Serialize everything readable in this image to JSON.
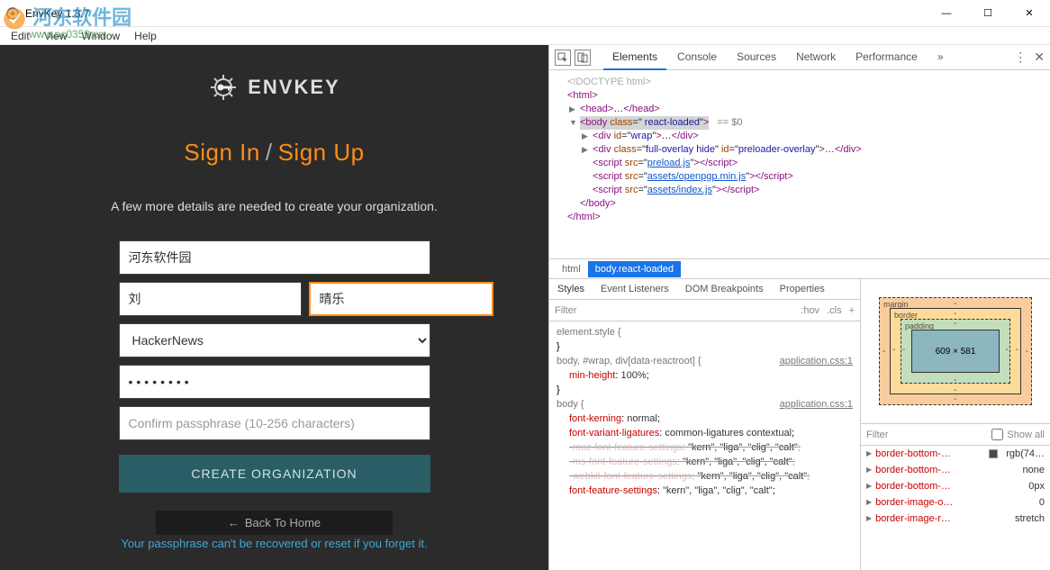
{
  "window": {
    "title": "EnvKey 1.3.7",
    "controls": {
      "min": "—",
      "max": "☐",
      "close": "✕"
    }
  },
  "menubar": {
    "items": [
      "Edit",
      "View",
      "Window",
      "Help"
    ]
  },
  "watermark": {
    "text": "河东软件园",
    "url": "www.pc0359.cn"
  },
  "logo": {
    "brand": "ENVKEY"
  },
  "heading": {
    "signin": "Sign In",
    "sep": "/",
    "signup": "Sign Up"
  },
  "subtext": "A few more details are needed to create your organization.",
  "form": {
    "org": "河东软件园",
    "first": "刘",
    "last": "晴乐",
    "source": "HackerNews",
    "pass": "••••••••",
    "confirm_placeholder": "Confirm passphrase (10-256 characters)",
    "submit": "CREATE ORGANIZATION"
  },
  "back": {
    "label": "Back To Home",
    "arrow": "←"
  },
  "warning": "Your passphrase can't be recovered or reset if you forget it.",
  "devtools": {
    "tabs": [
      "Elements",
      "Console",
      "Sources",
      "Network",
      "Performance"
    ],
    "more": "»",
    "tree": {
      "doctype": "<!DOCTYPE html>",
      "html_open": "<html>",
      "head": "head",
      "body_class": " react-loaded",
      "eq": " == $0",
      "wrap_id": "wrap",
      "overlay_class": "full-overlay hide",
      "overlay_id": "preloader-overlay",
      "scripts": [
        "preload.js",
        "assets/openpgp.min.js",
        "assets/index.js"
      ]
    },
    "breadcrumb": [
      "html",
      "body.react-loaded"
    ],
    "styles": {
      "tabs": [
        "Styles",
        "Event Listeners",
        "DOM Breakpoints",
        "Properties"
      ],
      "filter_label": "Filter",
      "hov": ":hov",
      "cls": ".cls",
      "plus": "+",
      "r1_sel": "element.style {",
      "r2_sel": "body, #wrap, div[data-reactroot] {",
      "r2_src": "application.css:1",
      "r2_prop": "min-height",
      "r2_val": "100%",
      "r3_sel": "body {",
      "r3_src": "application.css:1",
      "r3_p1": "font-kerning",
      "r3_v1": "normal",
      "r3_p2": "font-variant-ligatures",
      "r3_v2": "common-ligatures contextual",
      "r3_p3": "-moz-font-feature-settings",
      "r3_v3": "\"kern\", \"liga\", \"clig\", \"calt\"",
      "r3_p4": "-ms-font-feature-settings",
      "r3_v4": "\"kern\", \"liga\", \"clig\", \"calt\"",
      "r3_p5": "-webkit-font-feature-settings",
      "r3_v5": "\"kern\", \"liga\", \"clig\", \"calt\"",
      "r3_p6": "font-feature-settings",
      "r3_v6": "\"kern\", \"liga\", \"clig\", \"calt\""
    },
    "boxmodel": {
      "margin": "margin",
      "border": "border",
      "padding": "padding",
      "size": "609 × 581"
    },
    "computed": {
      "filter": "Filter",
      "showall": "Show all",
      "rows": [
        {
          "p": "border-bottom-…",
          "v": "rgb(74…",
          "sw": true
        },
        {
          "p": "border-bottom-…",
          "v": "none"
        },
        {
          "p": "border-bottom-…",
          "v": "0px"
        },
        {
          "p": "border-image-o…",
          "v": "0"
        },
        {
          "p": "border-image-r…",
          "v": "stretch"
        }
      ]
    }
  }
}
